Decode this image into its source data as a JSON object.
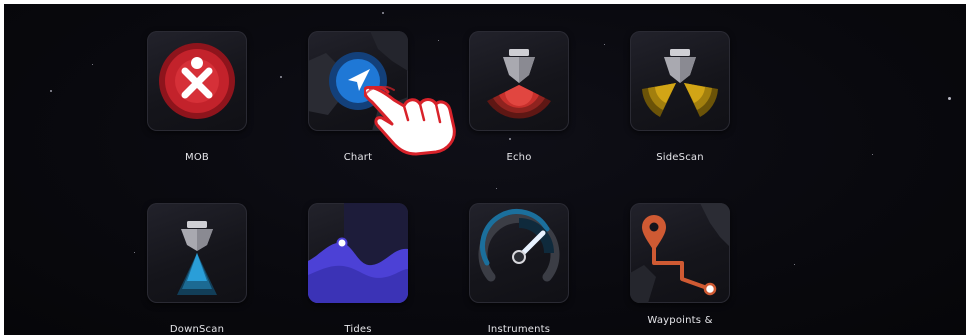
{
  "apps": [
    {
      "id": "mob",
      "label": "MOB",
      "icon": "mob-icon"
    },
    {
      "id": "chart",
      "label": "Chart",
      "icon": "navigation-arrow-icon"
    },
    {
      "id": "echo",
      "label": "Echo",
      "icon": "echo-sonar-icon"
    },
    {
      "id": "sidescan",
      "label": "SideScan",
      "icon": "sidescan-sonar-icon"
    },
    {
      "id": "downscan",
      "label": "DownScan",
      "icon": "downscan-sonar-icon"
    },
    {
      "id": "tides",
      "label": "Tides",
      "icon": "tides-wave-icon"
    },
    {
      "id": "instruments",
      "label": "Instruments",
      "icon": "speedometer-icon"
    },
    {
      "id": "waypoints",
      "label": "Waypoints &",
      "icon": "waypoint-route-icon"
    }
  ],
  "colors": {
    "background": "#09090e",
    "mob_red": "#c3222b",
    "chart_blue": "#1f78d6",
    "echo_red": "#c8302c",
    "sidescan_yellow": "#d2a516",
    "downscan_blue": "#2a9ed8",
    "tides_purple": "#4c41d6",
    "gauge_teal": "#1b6f9c",
    "waypoint_orange": "#cf5a33",
    "pointer_red": "#d8222a"
  },
  "overlay": {
    "icon": "pointing-hand-icon"
  }
}
